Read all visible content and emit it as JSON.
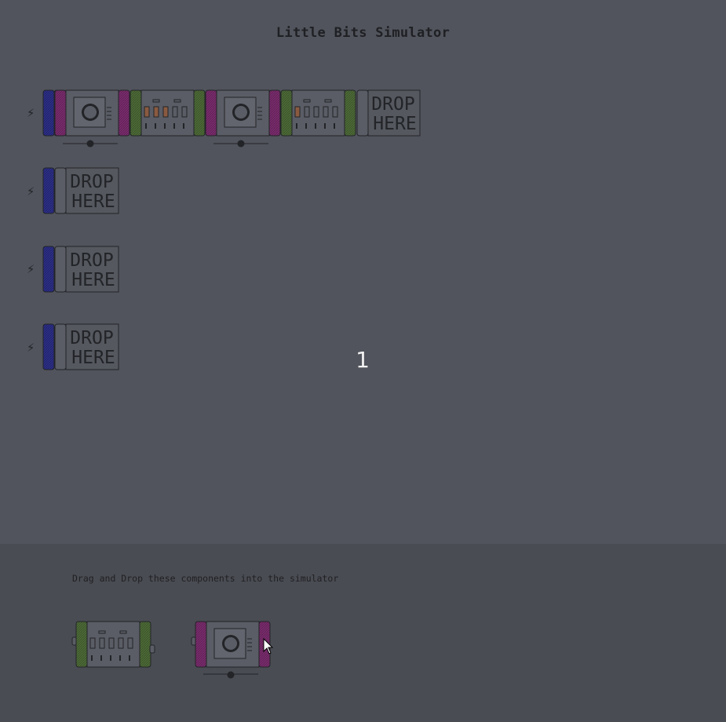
{
  "app": {
    "title": "Little Bits Simulator",
    "counter": "1"
  },
  "rows": [
    {
      "power_icon": "⚡",
      "drop_label_line1": "DROP",
      "drop_label_line2": "HERE",
      "modules": [
        "power",
        "dimmer",
        "bargraph",
        "dimmer",
        "bargraph"
      ]
    },
    {
      "power_icon": "⚡",
      "drop_label_line1": "DROP",
      "drop_label_line2": "HERE",
      "modules": [
        "power"
      ]
    },
    {
      "power_icon": "⚡",
      "drop_label_line1": "DROP",
      "drop_label_line2": "HERE",
      "modules": [
        "power"
      ]
    },
    {
      "power_icon": "⚡",
      "drop_label_line1": "DROP",
      "drop_label_line2": "HERE",
      "modules": [
        "power"
      ]
    }
  ],
  "palette": {
    "hint": "Drag and Drop these components into the simulator",
    "items": [
      "bargraph",
      "dimmer"
    ]
  },
  "colors": {
    "background": "#51545c",
    "palette_bg": "#4a4c53",
    "power_blue": "#2d2f86",
    "input_pink": "#7a2c6d",
    "output_green": "#4d6a37",
    "led_lit": "#8a5a40",
    "outline": "#222428"
  },
  "icons": {
    "power": "lightning-bolt-icon",
    "dimmer": "knob-icon",
    "cursor": "mouse-pointer-icon"
  }
}
